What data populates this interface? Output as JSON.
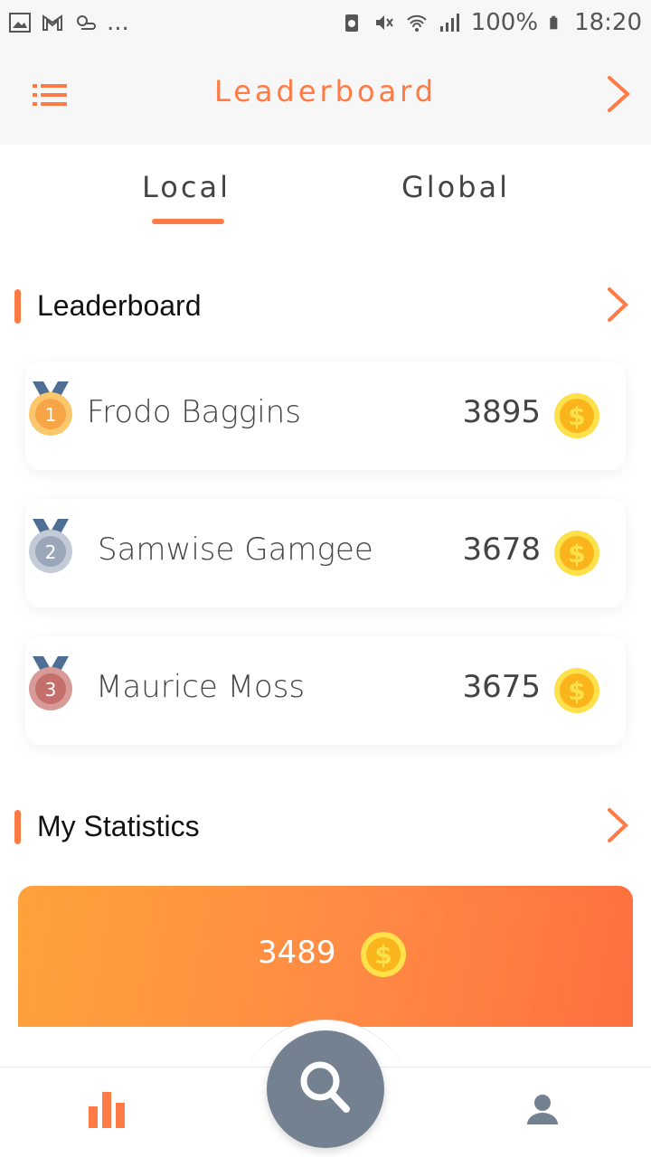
{
  "status_bar": {
    "battery": "100%",
    "time": "18:20",
    "more": "..."
  },
  "app_bar": {
    "title": "Leaderboard"
  },
  "tabs": [
    {
      "label": "Local",
      "active": true
    },
    {
      "label": "Global",
      "active": false
    }
  ],
  "leaderboard_section": {
    "title": "Leaderboard",
    "entries": [
      {
        "rank": "1",
        "name": "Frodo Baggins",
        "score": "3895",
        "medal_color": "#f7a546"
      },
      {
        "rank": "2",
        "name": "Samwise Gamgee",
        "score": "3678",
        "medal_color": "#9aa7b8"
      },
      {
        "rank": "3",
        "name": "Maurice Moss",
        "score": "3675",
        "medal_color": "#c46f6c"
      }
    ]
  },
  "statistics_section": {
    "title": "My Statistics",
    "coins": "3489"
  },
  "bottom_nav": {
    "items": [
      "stats-icon",
      "search-icon",
      "profile-icon"
    ]
  },
  "colors": {
    "accent": "#ff7a45",
    "coin": "#f9b51b",
    "nav_search_bg": "#748190"
  }
}
